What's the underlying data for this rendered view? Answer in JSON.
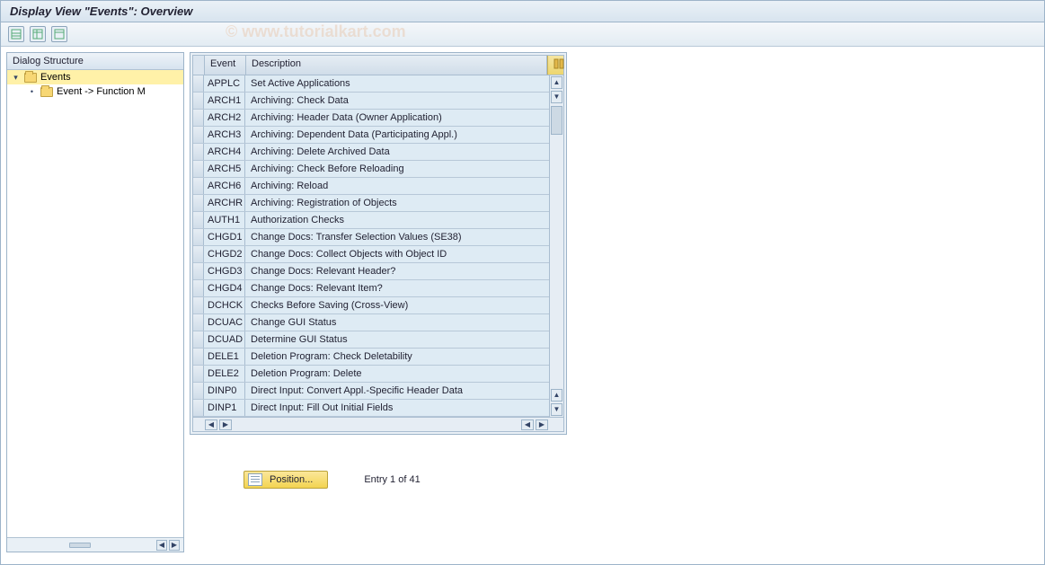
{
  "title": "Display View \"Events\": Overview",
  "watermark": "© www.tutorialkart.com",
  "toolbar_icons": [
    "table-levels-icon",
    "table-expand-icon",
    "table-collapse-icon"
  ],
  "sidebar": {
    "header": "Dialog Structure",
    "items": [
      {
        "label": "Events",
        "indent": 0,
        "open": true,
        "selected": true
      },
      {
        "label": "Event -> Function M",
        "indent": 1,
        "open": false,
        "selected": false
      }
    ]
  },
  "grid": {
    "col_event": "Event",
    "col_desc": "Description",
    "rows": [
      {
        "event": "APPLC",
        "desc": "Set Active Applications"
      },
      {
        "event": "ARCH1",
        "desc": "Archiving: Check Data"
      },
      {
        "event": "ARCH2",
        "desc": "Archiving: Header Data (Owner Application)"
      },
      {
        "event": "ARCH3",
        "desc": "Archiving: Dependent Data (Participating Appl.)"
      },
      {
        "event": "ARCH4",
        "desc": "Archiving: Delete Archived Data"
      },
      {
        "event": "ARCH5",
        "desc": "Archiving: Check Before Reloading"
      },
      {
        "event": "ARCH6",
        "desc": "Archiving: Reload"
      },
      {
        "event": "ARCHR",
        "desc": "Archiving: Registration of Objects"
      },
      {
        "event": "AUTH1",
        "desc": "Authorization Checks"
      },
      {
        "event": "CHGD1",
        "desc": "Change Docs: Transfer Selection Values (SE38)"
      },
      {
        "event": "CHGD2",
        "desc": "Change Docs: Collect Objects with Object ID"
      },
      {
        "event": "CHGD3",
        "desc": "Change Docs: Relevant Header?"
      },
      {
        "event": "CHGD4",
        "desc": "Change Docs: Relevant Item?"
      },
      {
        "event": "DCHCK",
        "desc": "Checks Before Saving (Cross-View)"
      },
      {
        "event": "DCUAC",
        "desc": "Change GUI Status"
      },
      {
        "event": "DCUAD",
        "desc": "Determine GUI Status"
      },
      {
        "event": "DELE1",
        "desc": "Deletion Program: Check Deletability"
      },
      {
        "event": "DELE2",
        "desc": "Deletion Program: Delete"
      },
      {
        "event": "DINP0",
        "desc": "Direct Input: Convert Appl.-Specific Header Data"
      },
      {
        "event": "DINP1",
        "desc": "Direct Input: Fill Out Initial Fields"
      }
    ]
  },
  "footer": {
    "position_label": "Position...",
    "entry_label": "Entry 1 of 41"
  }
}
